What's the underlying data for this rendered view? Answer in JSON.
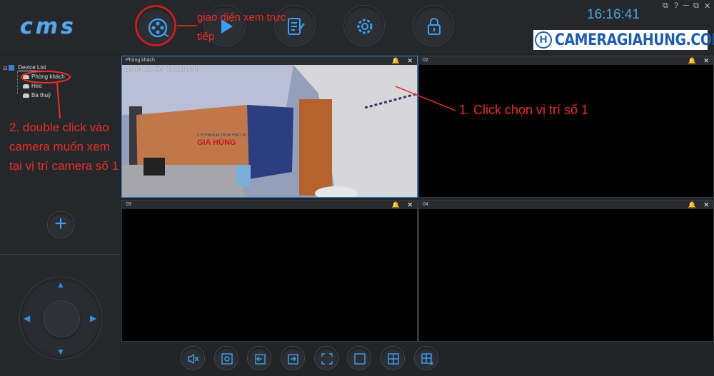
{
  "app": {
    "logo": "cms"
  },
  "clock": "16:16:41",
  "window_controls": [
    "⧉",
    "?",
    "─",
    "⧉",
    "✕"
  ],
  "brand": {
    "mark": "H",
    "text": "CAMERAGIAHUNG.COM"
  },
  "toolbar": {
    "buttons": [
      {
        "name": "live-view",
        "icon": "film-reel-icon",
        "active": true
      },
      {
        "name": "playback",
        "icon": "play-icon"
      },
      {
        "name": "log",
        "icon": "notepad-icon"
      },
      {
        "name": "settings",
        "icon": "gear-icon"
      },
      {
        "name": "lock",
        "icon": "lock-icon"
      }
    ]
  },
  "device_tree": {
    "root": "Device List",
    "items": [
      "Phòng khách",
      "Heo",
      "Bà thuỷ"
    ]
  },
  "annotations": {
    "live_view": "giao diện xem trực tiếp",
    "click_position": "1. Click chọn vị trí số 1",
    "double_click": "2. double click vào camera muốn xem tại vị trí camera số 1"
  },
  "panes": [
    {
      "title": "Phòng khách",
      "active": true,
      "osd": "2020-12-30  11:16:38",
      "banner_small": "CTY PHAN ĐI TH VA THIẾT BỊ",
      "banner_big": "GIA HÙNG"
    },
    {
      "title": "02"
    },
    {
      "title": "03"
    },
    {
      "title": "04"
    }
  ],
  "bottom_buttons": [
    "mute-icon",
    "snapshot-icon",
    "prev-icon",
    "next-icon",
    "fullscreen-icon",
    "layout-1-icon",
    "layout-4-icon",
    "layout-more-icon"
  ],
  "colors": {
    "accent": "#3aa0f0",
    "annotation": "#e8302a",
    "active_border": "#3c93df",
    "background": "#232428"
  }
}
